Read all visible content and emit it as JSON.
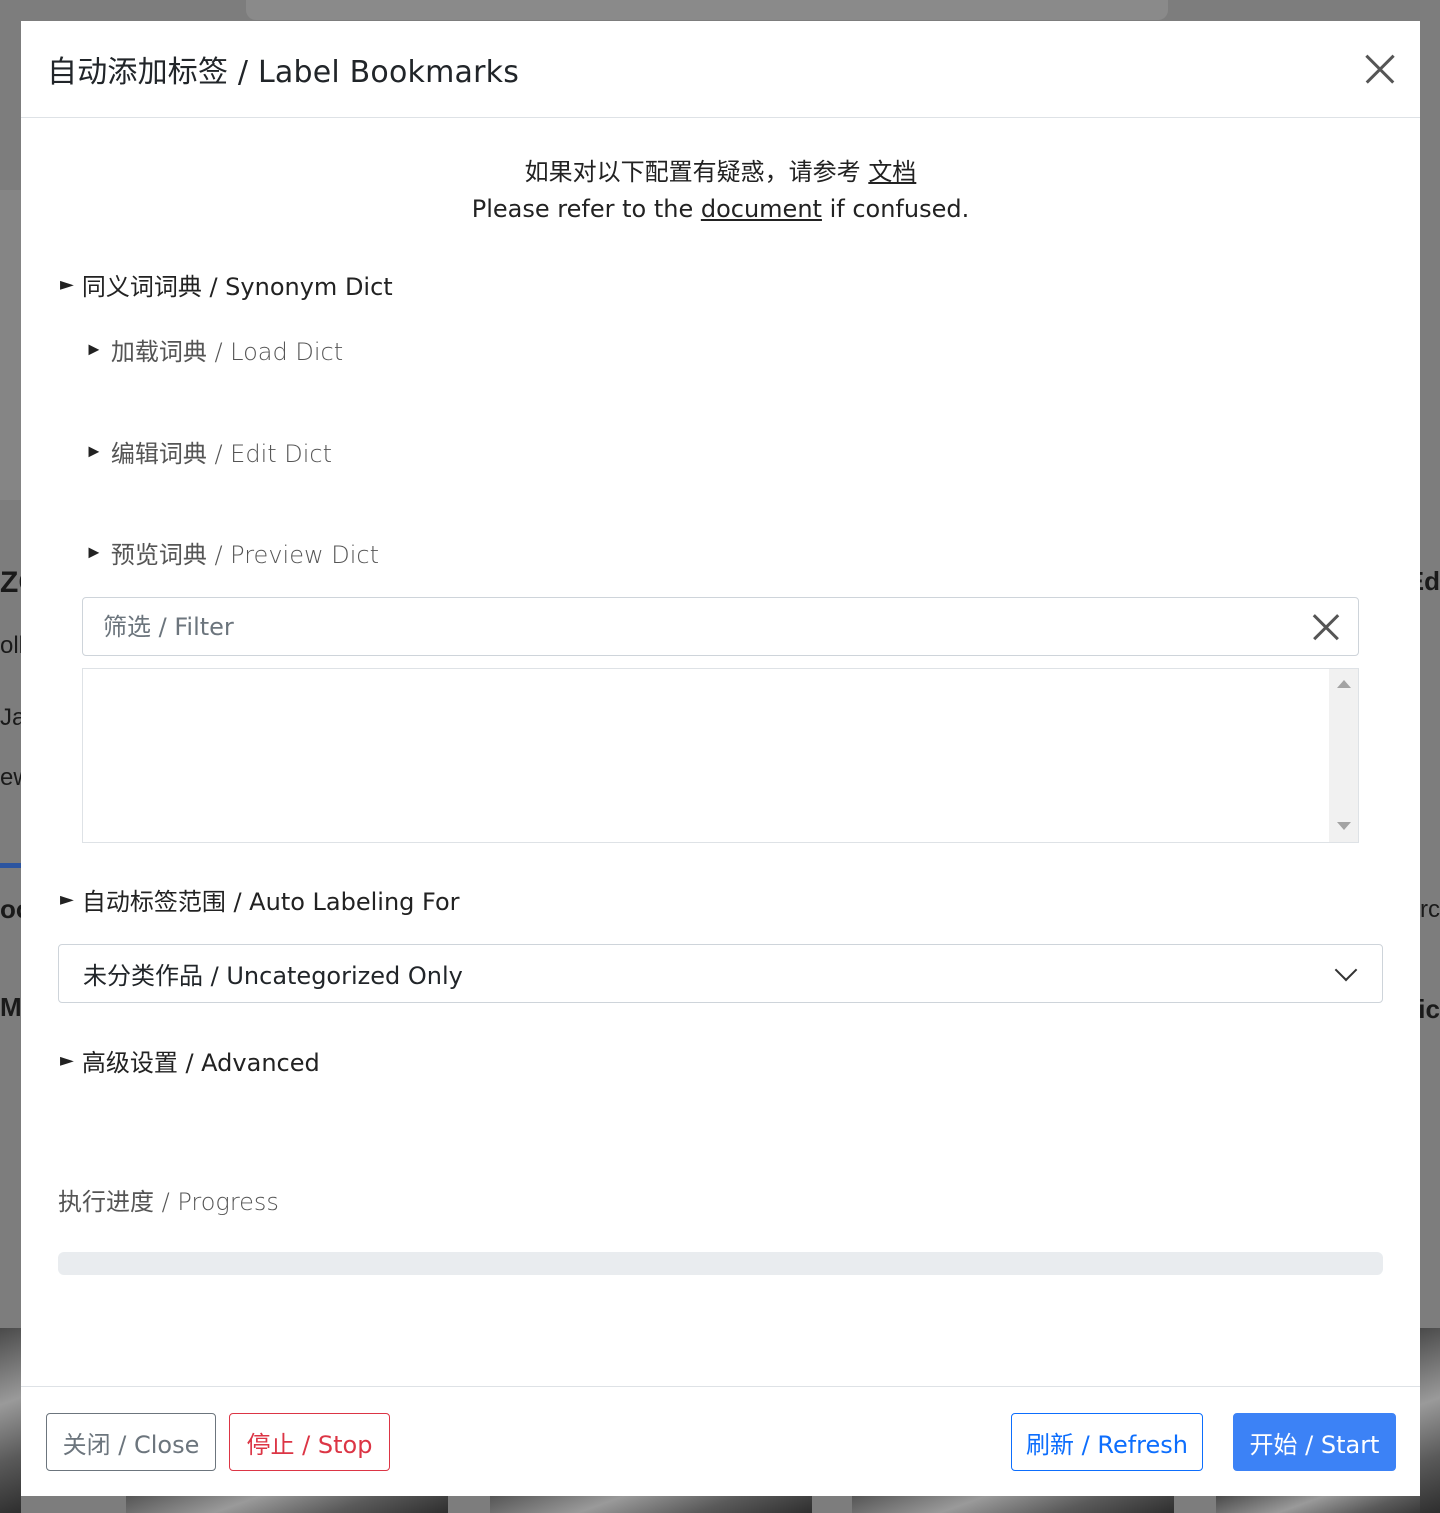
{
  "background": {
    "left_fragments": [
      "ZO",
      "oll",
      "Jap",
      "ew",
      "oo",
      "M"
    ],
    "right_fragments": [
      "Ed",
      "rc",
      "lic"
    ]
  },
  "modal": {
    "title": "自动添加标签 / Label Bookmarks",
    "notice": {
      "zh_text": "如果对以下配置有疑惑，请参考",
      "zh_link": "文档",
      "en_prefix": "Please refer to the",
      "en_link": "document",
      "en_suffix": "if confused."
    },
    "sections": {
      "synonym_dict": "同义词词典 / Synonym Dict",
      "load_dict": "加载词典 / Load Dict",
      "edit_dict": "编辑词典 / Edit Dict",
      "preview_dict": "预览词典 / Preview Dict",
      "auto_labeling_for": "自动标签范围 / Auto Labeling For",
      "advanced": "高级设置 / Advanced"
    },
    "filter": {
      "placeholder": "筛选 / Filter",
      "value": ""
    },
    "scope_select": {
      "selected": "未分类作品 / Uncategorized Only"
    },
    "progress": {
      "label": "执行进度 / Progress",
      "value": 0
    },
    "footer": {
      "close_label": "关闭 / Close",
      "stop_label": "停止 / Stop",
      "refresh_label": "刷新 / Refresh",
      "start_label": "开始 / Start"
    }
  },
  "icons": {
    "close": "close-icon",
    "clear_filter": "clear-filter-icon",
    "expand_arrow": "triangle-right-icon",
    "dropdown": "chevron-down-icon"
  },
  "colors": {
    "primary": "#0d6efd",
    "start_button": "#3c82f6",
    "danger": "#dc3545",
    "secondary": "#6c757d",
    "progress_track": "#e9ecef"
  }
}
